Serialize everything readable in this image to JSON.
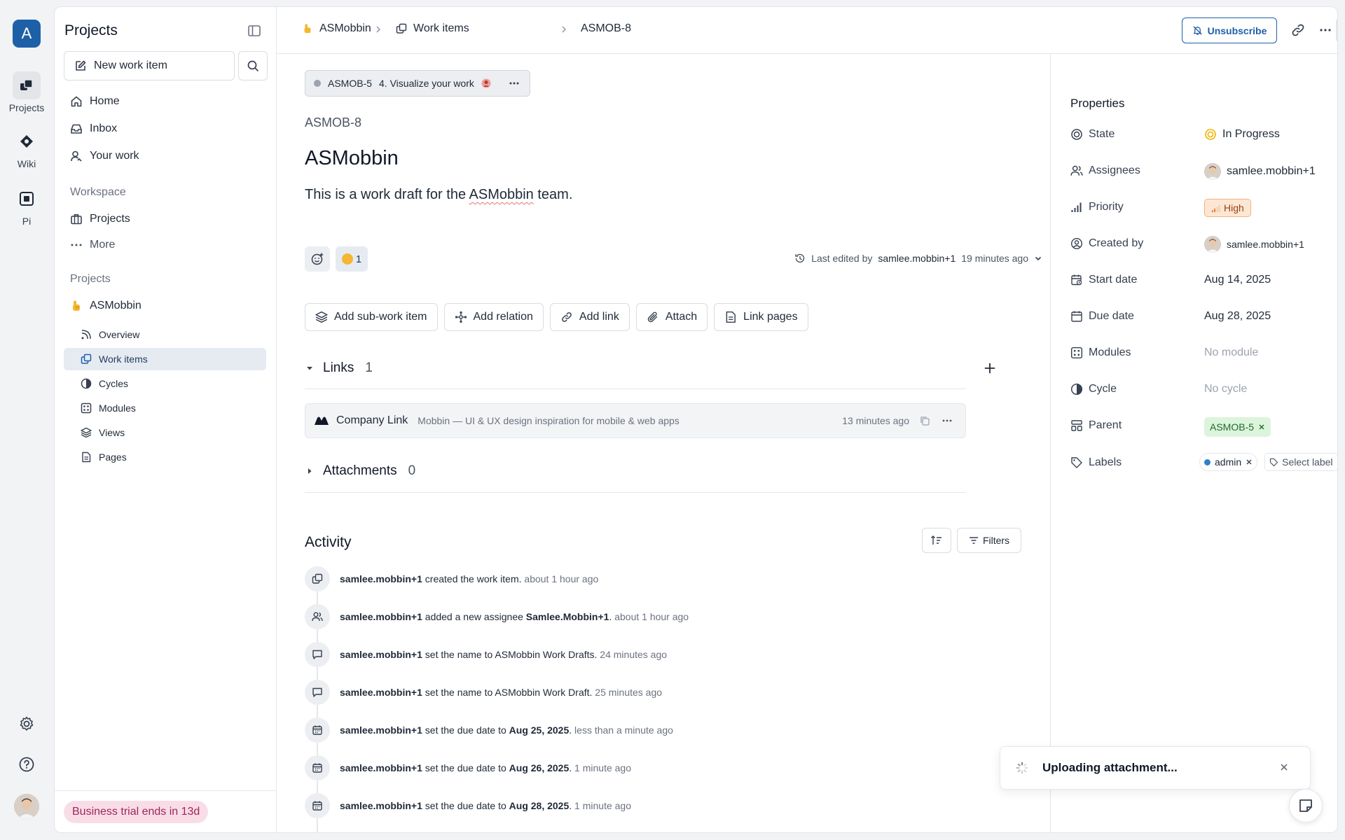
{
  "rail": {
    "workspace_initial": "A",
    "items": [
      {
        "label": "Projects",
        "icon": "projects-icon"
      },
      {
        "label": "Wiki",
        "icon": "wiki-icon"
      },
      {
        "label": "Pi",
        "icon": "pi-icon"
      }
    ]
  },
  "sidebar": {
    "title": "Projects",
    "new_item_label": "New work item",
    "nav": [
      {
        "label": "Home",
        "icon": "home-icon"
      },
      {
        "label": "Inbox",
        "icon": "inbox-icon"
      },
      {
        "label": "Your work",
        "icon": "user-icon"
      }
    ],
    "workspace_section": "Workspace",
    "workspace_items": [
      {
        "label": "Projects",
        "icon": "briefcase-icon"
      },
      {
        "label": "More",
        "icon": "dots-icon"
      }
    ],
    "projects_section": "Projects",
    "project_name": "ASMobbin",
    "project_items": [
      {
        "label": "Overview"
      },
      {
        "label": "Work items"
      },
      {
        "label": "Cycles"
      },
      {
        "label": "Modules"
      },
      {
        "label": "Views"
      },
      {
        "label": "Pages"
      }
    ],
    "trial_text": "Business trial ends in 13d"
  },
  "header": {
    "crumbs": [
      "ASMobbin",
      "Work items",
      "ASMOB-8"
    ],
    "unsubscribe_label": "Unsubscribe"
  },
  "work_item": {
    "parent_id": "ASMOB-5",
    "parent_name": "4. Visualize your work",
    "id": "ASMOB-8",
    "title": "ASMobbin",
    "description_pre": "This is a work draft for the ",
    "description_word": "ASMobbin",
    "description_post": " team.",
    "reaction_count": "1",
    "last_edited_prefix": "Last edited by",
    "last_edited_user": "samlee.mobbin+1",
    "last_edited_time": "19 minutes ago",
    "actions": [
      "Add sub-work item",
      "Add relation",
      "Add link",
      "Attach",
      "Link pages"
    ],
    "links_title": "Links",
    "links_count": "1",
    "link": {
      "name": "Company Link",
      "description": "Mobbin — UI & UX design inspiration for mobile & web apps",
      "time": "13 minutes ago"
    },
    "attachments_title": "Attachments",
    "attachments_count": "0"
  },
  "activity": {
    "title": "Activity",
    "filters_label": "Filters",
    "entries": [
      {
        "user": "samlee.mobbin+1",
        "text": " created the work item.",
        "bold": "",
        "tail": "",
        "time": " about 1 hour ago"
      },
      {
        "user": "samlee.mobbin+1",
        "text": " added a new assignee ",
        "bold": "Samlee.Mobbin+1",
        "tail": ".",
        "time": " about 1 hour ago"
      },
      {
        "user": "samlee.mobbin+1",
        "text": " set the name to ASMobbin Work Drafts.",
        "bold": "",
        "tail": "",
        "time": " 24 minutes ago"
      },
      {
        "user": "samlee.mobbin+1",
        "text": " set the name to ASMobbin Work Draft.",
        "bold": "",
        "tail": "",
        "time": " 25 minutes ago"
      },
      {
        "user": "samlee.mobbin+1",
        "text": " set the due date to ",
        "bold": "Aug 25, 2025",
        "tail": ".",
        "time": " less than a minute ago"
      },
      {
        "user": "samlee.mobbin+1",
        "text": " set the due date to ",
        "bold": "Aug 26, 2025",
        "tail": ".",
        "time": " 1 minute ago"
      },
      {
        "user": "samlee.mobbin+1",
        "text": " set the due date to ",
        "bold": "Aug 28, 2025",
        "tail": ".",
        "time": " 1 minute ago"
      }
    ]
  },
  "properties": {
    "title": "Properties",
    "state_label": "State",
    "state_value": "In Progress",
    "assignees_label": "Assignees",
    "assignees_value": "samlee.mobbin+1",
    "priority_label": "Priority",
    "priority_value": "High",
    "created_by_label": "Created by",
    "created_by_value": "samlee.mobbin+1",
    "start_date_label": "Start date",
    "start_date_value": "Aug 14, 2025",
    "due_date_label": "Due date",
    "due_date_value": "Aug 28, 2025",
    "modules_label": "Modules",
    "modules_value": "No module",
    "cycle_label": "Cycle",
    "cycle_value": "No cycle",
    "parent_label": "Parent",
    "parent_value": "ASMOB-5",
    "labels_label": "Labels",
    "label_admin": "admin",
    "select_label": "Select label"
  },
  "toast": {
    "text": "Uploading attachment..."
  },
  "colors": {
    "accent": "#1e60a8",
    "trial_bg": "#f8dde7",
    "state": "#f0b400",
    "priority": "#f3b27a",
    "parent": "#dcf4dc"
  }
}
